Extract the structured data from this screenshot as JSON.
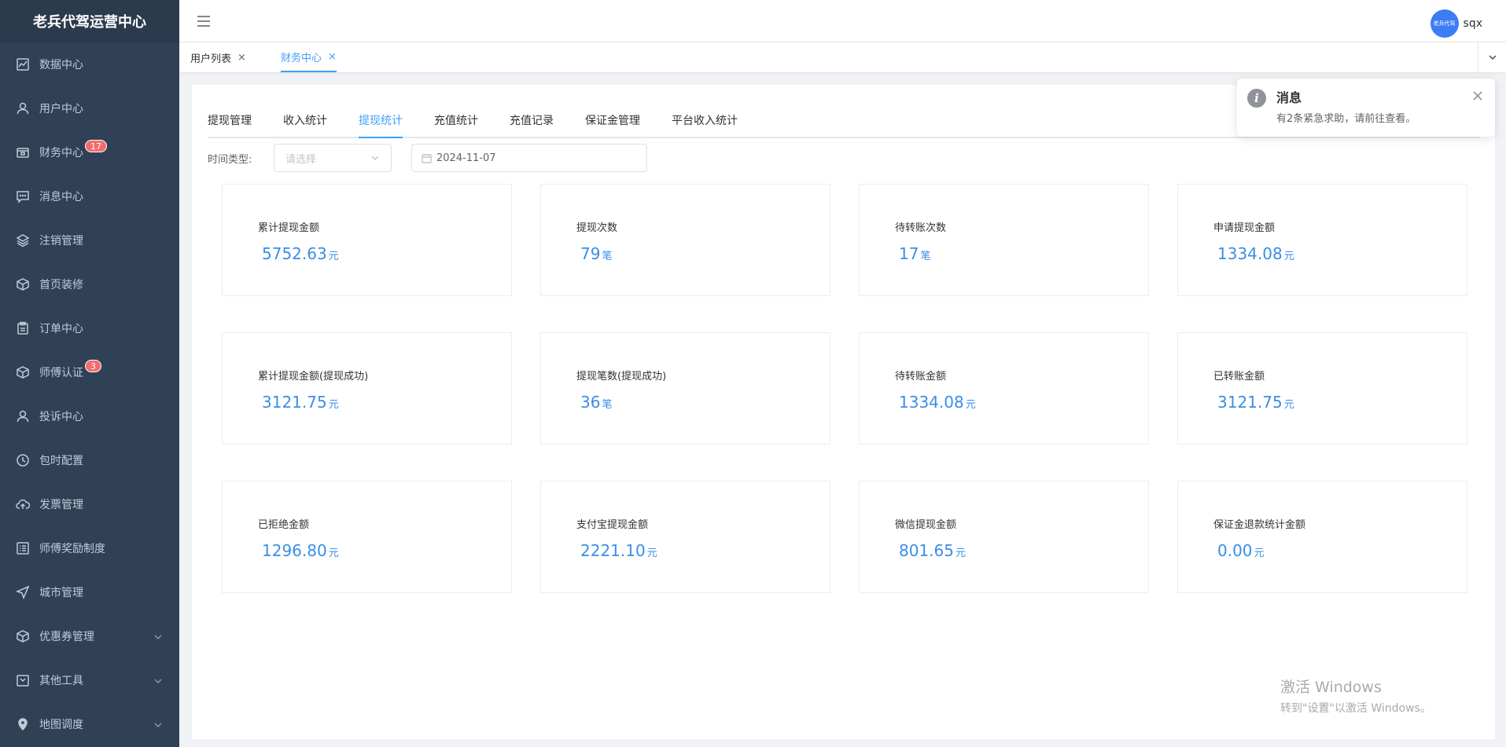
{
  "sidebar": {
    "brand": "老兵代驾运营中心",
    "items": [
      {
        "label": "数据中心",
        "icon": "chart-line-icon"
      },
      {
        "label": "用户中心",
        "icon": "user-icon"
      },
      {
        "label": "财务中心",
        "icon": "wallet-icon",
        "badge": "17"
      },
      {
        "label": "消息中心",
        "icon": "message-icon"
      },
      {
        "label": "注销管理",
        "icon": "layers-icon"
      },
      {
        "label": "首页装修",
        "icon": "box-icon"
      },
      {
        "label": "订单中心",
        "icon": "clipboard-icon"
      },
      {
        "label": "师傅认证",
        "icon": "box-icon",
        "badge": "3"
      },
      {
        "label": "投诉中心",
        "icon": "user-icon"
      },
      {
        "label": "包时配置",
        "icon": "clock-icon"
      },
      {
        "label": "发票管理",
        "icon": "cloud-upload-icon"
      },
      {
        "label": "师傅奖励制度",
        "icon": "list-icon"
      },
      {
        "label": "城市管理",
        "icon": "send-icon"
      },
      {
        "label": "优惠券管理",
        "icon": "box-icon",
        "expandable": true
      },
      {
        "label": "其他工具",
        "icon": "calendar-icon",
        "expandable": true
      },
      {
        "label": "地图调度",
        "icon": "location-icon",
        "expandable": true
      }
    ]
  },
  "header": {
    "avatar_text": "老兵代驾",
    "username": "sqx"
  },
  "tags": [
    {
      "label": "用户列表",
      "close": "×"
    },
    {
      "label": "财务中心",
      "close": "×"
    }
  ],
  "tabs": [
    "提现管理",
    "收入统计",
    "提现统计",
    "充值统计",
    "充值记录",
    "保证金管理",
    "平台收入统计"
  ],
  "filter": {
    "label": "时间类型:",
    "select_placeholder": "请选择",
    "date_value": "2024-11-07"
  },
  "stats": [
    {
      "label": "累计提现金额",
      "value": "5752.63",
      "unit": "元"
    },
    {
      "label": "提现次数",
      "value": "79",
      "unit": "笔"
    },
    {
      "label": "待转账次数",
      "value": "17",
      "unit": "笔"
    },
    {
      "label": "申请提现金额",
      "value": "1334.08",
      "unit": "元"
    },
    {
      "label": "累计提现金额(提现成功)",
      "value": "3121.75",
      "unit": "元"
    },
    {
      "label": "提现笔数(提现成功)",
      "value": "36",
      "unit": "笔"
    },
    {
      "label": "待转账金额",
      "value": "1334.08",
      "unit": "元"
    },
    {
      "label": "已转账金额",
      "value": "3121.75",
      "unit": "元"
    },
    {
      "label": "已拒绝金额",
      "value": "1296.80",
      "unit": "元"
    },
    {
      "label": "支付宝提现金额",
      "value": "2221.10",
      "unit": "元"
    },
    {
      "label": "微信提现金额",
      "value": "801.65",
      "unit": "元"
    },
    {
      "label": "保证金退款统计金额",
      "value": "0.00",
      "unit": "元"
    }
  ],
  "notification": {
    "icon_text": "i",
    "title": "消息",
    "message": "有2条紧急求助，请前往查看。"
  },
  "watermark": {
    "title": "激活 Windows",
    "subtitle": "转到\"设置\"以激活 Windows。"
  },
  "colors": {
    "sidebar_bg": "#304156",
    "accent": "#409eff",
    "value_blue": "#3a8ee6",
    "badge_red": "#f56c6c"
  }
}
